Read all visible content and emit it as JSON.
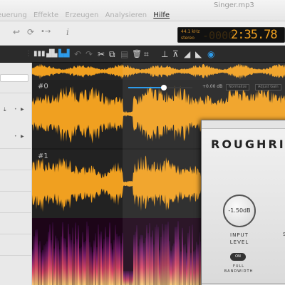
{
  "app": {
    "doc_title": "Singer.mp3"
  },
  "menu": [
    {
      "label": "euerung",
      "active": false
    },
    {
      "label": "Effekte",
      "active": false
    },
    {
      "label": "Erzeugen",
      "active": false
    },
    {
      "label": "Analysieren",
      "active": false
    },
    {
      "label": "Hilfe",
      "active": true
    }
  ],
  "toolbar": {
    "undo_icon": "↩",
    "redo_icon": "⟳",
    "forward_icon": "•→",
    "info_icon": "i"
  },
  "lcd": {
    "sample_rate": "44.1 kHz",
    "channels": "stereo",
    "dim_digits": "-0000",
    "time": "2:35.78"
  },
  "edit_tools": [
    {
      "name": "waveform-view-icon",
      "glyph": "▮▮▮",
      "state": "normal"
    },
    {
      "name": "spectral-view-icon",
      "glyph": "▟▙",
      "state": "normal"
    },
    {
      "name": "combined-view-icon",
      "glyph": "▙▟",
      "state": "blue"
    },
    {
      "name": "undo-icon",
      "glyph": "↶",
      "state": "dim"
    },
    {
      "name": "redo-icon",
      "glyph": "↷",
      "state": "dim"
    },
    {
      "name": "cut-icon",
      "glyph": "✂",
      "state": "normal"
    },
    {
      "name": "copy-icon",
      "glyph": "⧉",
      "state": "normal"
    },
    {
      "name": "paste-icon",
      "glyph": "▤",
      "state": "dim"
    },
    {
      "name": "delete-icon",
      "glyph": "🗑",
      "state": "normal"
    },
    {
      "name": "crop-icon",
      "glyph": "⌗",
      "state": "normal"
    },
    {
      "name": "trim-icon",
      "glyph": "⊥",
      "state": "normal"
    },
    {
      "name": "normalize-icon",
      "glyph": "⊼",
      "state": "normal"
    },
    {
      "name": "fade-in-icon",
      "glyph": "◢",
      "state": "normal"
    },
    {
      "name": "fade-out-icon",
      "glyph": "◣",
      "state": "normal"
    },
    {
      "name": "effects-icon",
      "glyph": "◉",
      "state": "blue"
    }
  ],
  "tracks": [
    {
      "label": "#0"
    },
    {
      "label": "#1"
    }
  ],
  "volume": {
    "db_label": "+0.00 dB",
    "level": 0.55,
    "button1": "Normalize",
    "button2": "Adjust Gain"
  },
  "plugin": {
    "title": "ROUGHRIDER",
    "input_knob_value": "-1.50dB",
    "input_label": "INPUT LEVEL",
    "on_button": "ON",
    "full_bandwidth_label": "FULL BANDWIDTH",
    "second_label": "S"
  },
  "colors": {
    "waveform": "#f0a020",
    "accent": "#2d9bea"
  }
}
